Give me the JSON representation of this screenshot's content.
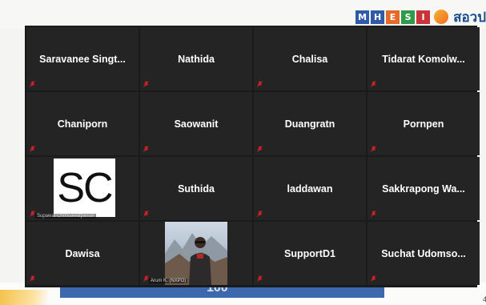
{
  "slide": {
    "logo_letters": [
      {
        "letter": "M",
        "color": "#2f5aa8"
      },
      {
        "letter": "H",
        "color": "#2f5aa8"
      },
      {
        "letter": "E",
        "color": "#e46a2a"
      },
      {
        "letter": "S",
        "color": "#2e9b4a"
      },
      {
        "letter": "I",
        "color": "#c8343a"
      }
    ],
    "thai_text": "สอวป",
    "page_number": "100"
  },
  "participants": [
    {
      "name": "Saravanee Singt..."
    },
    {
      "name": "Nathida"
    },
    {
      "name": "Chalisa"
    },
    {
      "name": "Tidarat Komolw..."
    },
    {
      "name": "Chaniporn"
    },
    {
      "name": "Saowanit"
    },
    {
      "name": "Duangratn"
    },
    {
      "name": "Pornpen"
    },
    {
      "name": "",
      "avatar_initials": "SC",
      "label": "Supawat Chotisawatpaisan"
    },
    {
      "name": "Suthida"
    },
    {
      "name": "laddawan"
    },
    {
      "name": "Sakkrapong Wa..."
    },
    {
      "name": "Dawisa"
    },
    {
      "name": "",
      "photo": true,
      "label": "Arum K. (NXPO)"
    },
    {
      "name": "SupportD1"
    },
    {
      "name": "Suchat Udomso..."
    }
  ],
  "colors": {
    "muted_mic": "#e0202a",
    "tile_bg": "#242424",
    "gallery_bg": "#1a1a1a"
  }
}
